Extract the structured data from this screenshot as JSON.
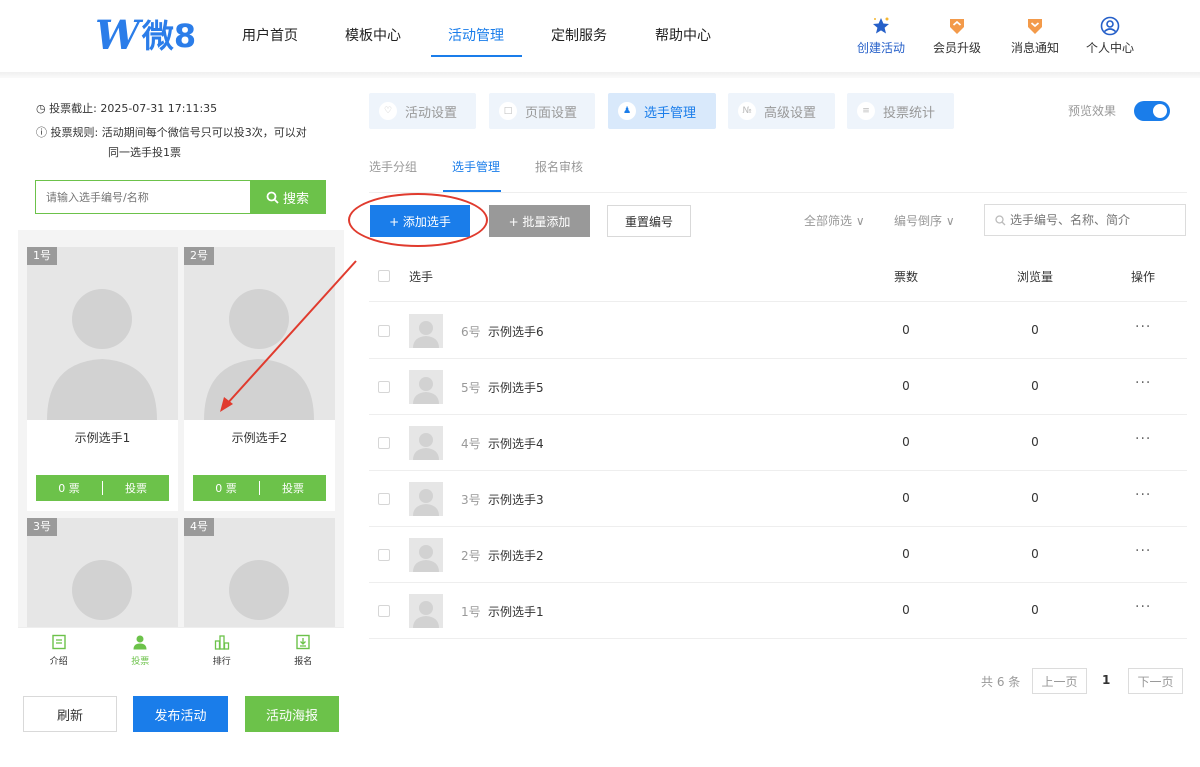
{
  "header": {
    "logo_text": "微8",
    "nav": [
      "用户首页",
      "模板中心",
      "活动管理",
      "定制服务",
      "帮助中心"
    ],
    "tools": {
      "create": "创建活动",
      "upgrade": "会员升级",
      "notify": "消息通知",
      "profile": "个人中心"
    }
  },
  "preview": {
    "deadline_label": "投票截止:",
    "deadline_value": "2025-07-31 17:11:35",
    "rule_label": "投票规则:",
    "rule_line1": "活动期间每个微信号只可以投3次，可以对",
    "rule_line2": "同一选手投1票",
    "search_placeholder": "请输入选手编号/名称",
    "search_button": "搜索",
    "cards": [
      {
        "num": "1号",
        "name": "示例选手1",
        "votes": "0 票",
        "vote_btn": "投票"
      },
      {
        "num": "2号",
        "name": "示例选手2",
        "votes": "0 票",
        "vote_btn": "投票"
      },
      {
        "num": "3号"
      },
      {
        "num": "4号"
      }
    ],
    "bottom_tabs": [
      "介绍",
      "投票",
      "排行",
      "报名"
    ]
  },
  "actions": {
    "refresh": "刷新",
    "publish": "发布活动",
    "poster": "活动海报"
  },
  "settings_tabs": [
    "活动设置",
    "页面设置",
    "选手管理",
    "高级设置",
    "投票统计"
  ],
  "preview_toggle_label": "预览效果",
  "sub_tabs": [
    "选手分组",
    "选手管理",
    "报名审核"
  ],
  "toolbar": {
    "add": "+ 添加选手",
    "batch_add": "+ 批量添加",
    "reset_numbers": "重置编号",
    "filter_all": "全部筛选 ∨",
    "sort": "编号倒序 ∨",
    "search_placeholder": "选手编号、名称、简介"
  },
  "table": {
    "headers": {
      "player": "选手",
      "votes": "票数",
      "views": "浏览量",
      "ops": "操作"
    },
    "rows": [
      {
        "num": "6号",
        "name": "示例选手6",
        "votes": "0",
        "views": "0",
        "ops": "···"
      },
      {
        "num": "5号",
        "name": "示例选手5",
        "votes": "0",
        "views": "0",
        "ops": "···"
      },
      {
        "num": "4号",
        "name": "示例选手4",
        "votes": "0",
        "views": "0",
        "ops": "···"
      },
      {
        "num": "3号",
        "name": "示例选手3",
        "votes": "0",
        "views": "0",
        "ops": "···"
      },
      {
        "num": "2号",
        "name": "示例选手2",
        "votes": "0",
        "views": "0",
        "ops": "···"
      },
      {
        "num": "1号",
        "name": "示例选手1",
        "votes": "0",
        "views": "0",
        "ops": "···"
      }
    ]
  },
  "pagination": {
    "total": "共 6 条",
    "prev": "上一页",
    "current": "1",
    "next": "下一页"
  },
  "colors": {
    "primary": "#1a7dea",
    "green": "#6cc24a",
    "annotation_red": "#e03b2e"
  }
}
